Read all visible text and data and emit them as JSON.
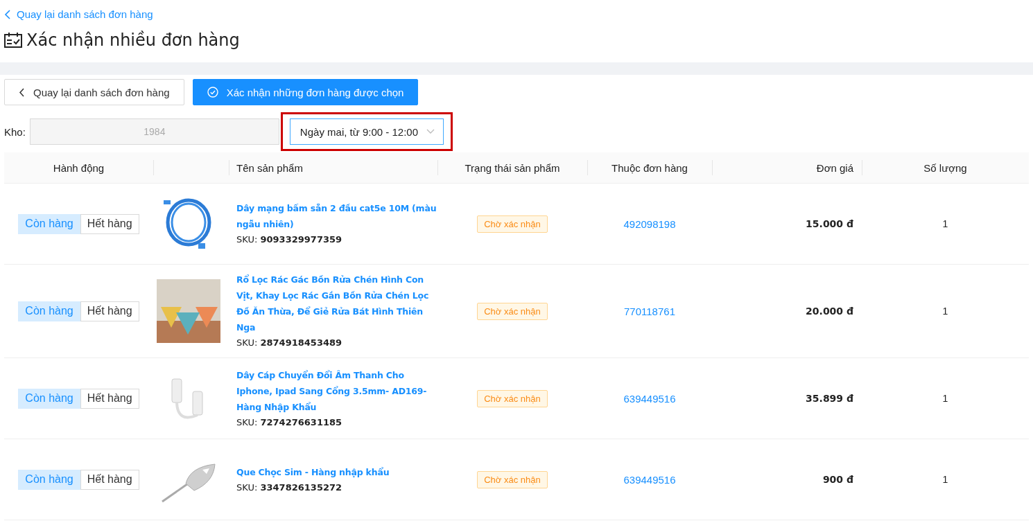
{
  "back_link": "Quay lại danh sách đơn hàng",
  "title": "Xác nhận nhiều đơn hàng",
  "toolbar": {
    "back_button": "Quay lại danh sách đơn hàng",
    "confirm_button": "Xác nhận những đơn hàng được chọn"
  },
  "filters": {
    "warehouse_label": "Kho:",
    "warehouse_value": "1984",
    "delivery_time": "Ngày mai, từ 9:00 - 12:00"
  },
  "table": {
    "columns": [
      "Hành động",
      "",
      "Tên sản phẩm",
      "Trạng thái sản phẩm",
      "Thuộc đơn hàng",
      "Đơn giá",
      "Số lượng"
    ],
    "rows": [
      {
        "stock_options": [
          {
            "label": "Còn hàng",
            "selected": true
          },
          {
            "label": "Hết hàng",
            "selected": false
          }
        ],
        "kind": "cable",
        "name": "Dây mạng bấm sẵn 2 đầu cat5e 10M (màu ngẫu nhiên)",
        "sku_label": "SKU:",
        "sku": "9093329977359",
        "status": "Chờ xác nhận",
        "order": "492098198",
        "price": "15.000 đ",
        "quantity": "1"
      },
      {
        "stock_options": [
          {
            "label": "Còn hàng",
            "selected": true
          },
          {
            "label": "Hết hàng",
            "selected": false
          }
        ],
        "kind": "basket",
        "name": "Rổ Lọc Rác Gác Bồn Rửa Chén Hình Con Vịt, Khay Lọc Rác Gắn Bồn Rửa Chén Lọc Đồ Ăn Thừa, Để Giẻ Rửa Bát Hình Thiên Nga",
        "sku_label": "SKU:",
        "sku": "2874918453489",
        "status": "Chờ xác nhận",
        "order": "770118761",
        "price": "20.000 đ",
        "quantity": "1"
      },
      {
        "stock_options": [
          {
            "label": "Còn hàng",
            "selected": true
          },
          {
            "label": "Hết hàng",
            "selected": false
          }
        ],
        "kind": "adapter",
        "name": "Dây Cáp Chuyển Đổi Âm Thanh Cho Iphone, Ipad Sang Cổng 3.5mm- AD169- Hàng Nhập Khẩu",
        "sku_label": "SKU:",
        "sku": "7274276631185",
        "status": "Chờ xác nhận",
        "order": "639449516",
        "price": "35.899 đ",
        "quantity": "1"
      },
      {
        "stock_options": [
          {
            "label": "Còn hàng",
            "selected": true
          },
          {
            "label": "Hết hàng",
            "selected": false
          }
        ],
        "kind": "pin",
        "name": "Que Chọc Sim - Hàng nhập khẩu",
        "sku_label": "SKU:",
        "sku": "3347826135272",
        "status": "Chờ xác nhận",
        "order": "639449516",
        "price": "900 đ",
        "quantity": "1"
      }
    ]
  }
}
